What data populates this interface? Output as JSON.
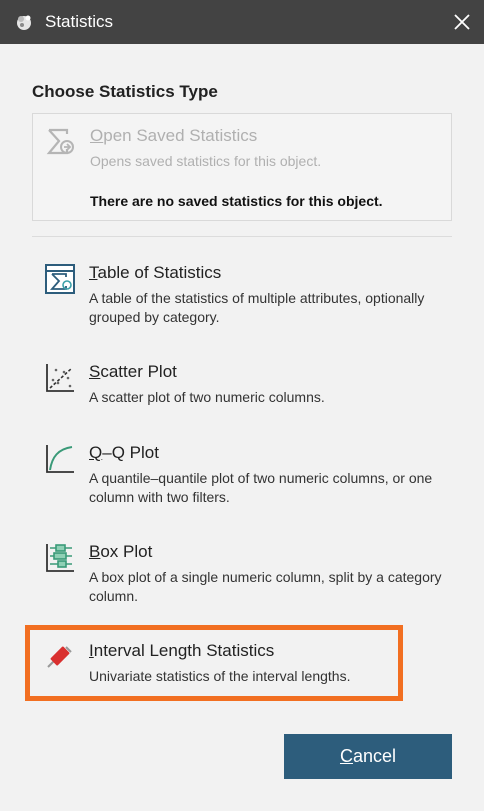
{
  "window": {
    "title": "Statistics",
    "app_icon": "leapfrog-icon",
    "close_icon": "close-icon"
  },
  "heading": "Choose Statistics Type",
  "saved": {
    "title_mnemonic": "O",
    "title_rest": "pen Saved Statistics",
    "description": "Opens saved statistics for this object.",
    "note": "There are no saved statistics for this object.",
    "icon": "sigma-open-icon",
    "enabled": false
  },
  "options": [
    {
      "mnemonic": "T",
      "rest": "able of Statistics",
      "description": "A table of the statistics of multiple attributes, optionally grouped by category.",
      "icon": "table-sigma-icon"
    },
    {
      "mnemonic": "S",
      "rest": "catter Plot",
      "description": "A scatter plot of two numeric columns.",
      "icon": "scatter-plot-icon"
    },
    {
      "mnemonic": "Q",
      "rest": "–Q Plot",
      "description": "A quantile–quantile plot of two numeric columns, or one column with two filters.",
      "icon": "qq-plot-icon"
    },
    {
      "mnemonic": "B",
      "rest": "ox Plot",
      "description": "A box plot of a single numeric column, split by a category column.",
      "icon": "box-plot-icon"
    },
    {
      "mnemonic": "I",
      "rest": "nterval Length Statistics",
      "description": "Univariate statistics of the interval lengths.",
      "icon": "interval-length-icon",
      "highlighted": true
    }
  ],
  "cancel": {
    "mnemonic": "C",
    "rest": "ancel"
  },
  "colors": {
    "titlebar": "#434343",
    "button": "#2d5d7c",
    "highlight": "#f26f21"
  }
}
